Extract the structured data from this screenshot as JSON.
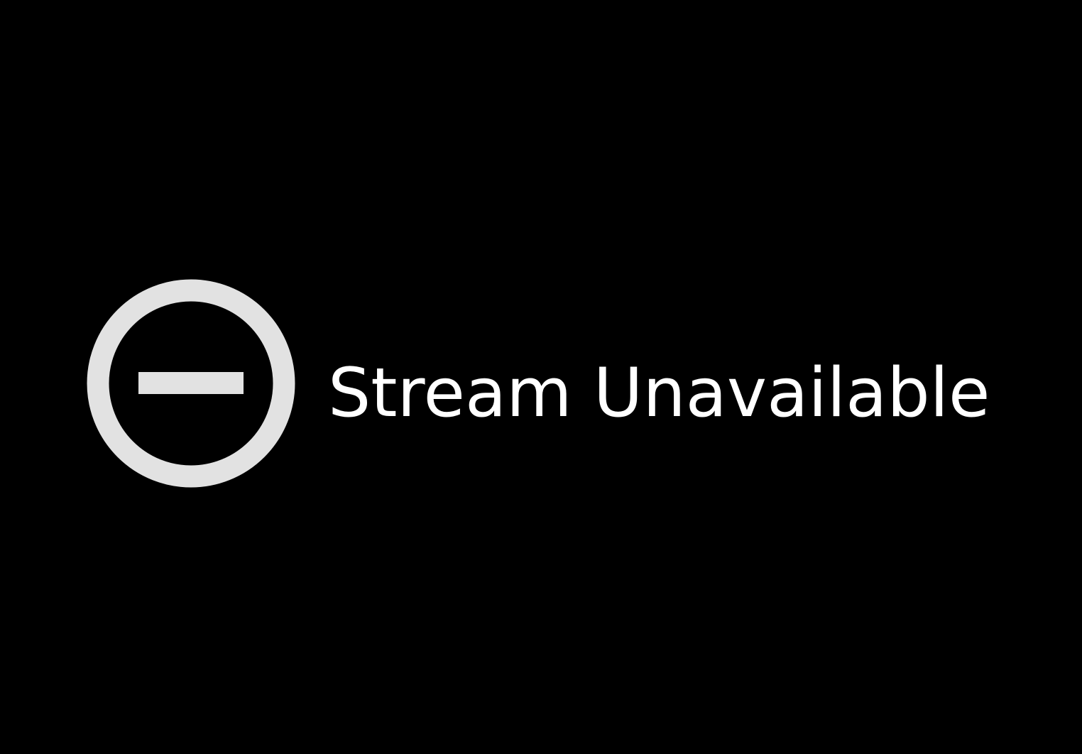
{
  "stream": {
    "status_text": "Stream Unavailable",
    "icon": "blocked-icon"
  },
  "colors": {
    "background": "#000000",
    "icon": "#e2e2e2",
    "text": "#ffffff"
  }
}
